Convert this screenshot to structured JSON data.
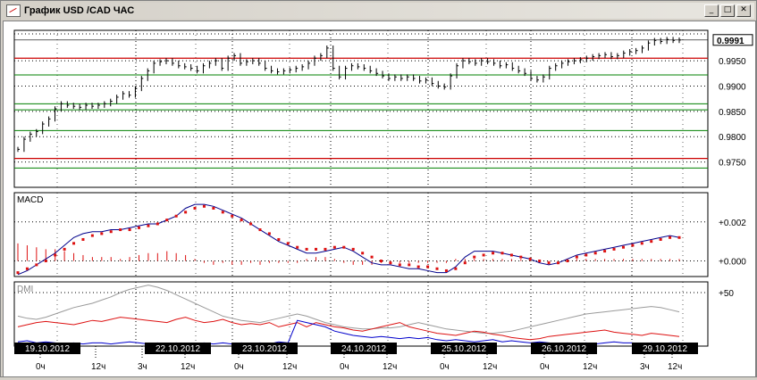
{
  "window": {
    "title": "График USD /CAD  ЧАС",
    "buttons": {
      "minimize": "_",
      "maximize": "□",
      "close": "✕"
    }
  },
  "chart_data": [
    {
      "type": "line",
      "panel": "price",
      "ylim": [
        0.97,
        1.001
      ],
      "yticks": [
        0.975,
        0.98,
        0.985,
        0.99,
        0.995
      ],
      "ytick_labels": [
        "0.9750",
        "0.9800",
        "0.9850",
        "0.9900",
        "0.9950"
      ],
      "last_value_label": "0.9991",
      "last_value": 0.9991,
      "levels_red": [
        0.9955,
        0.9757
      ],
      "levels_green": [
        0.9922,
        0.9865,
        0.9853,
        0.9812,
        0.9738
      ],
      "close": [
        0.9775,
        0.9795,
        0.9805,
        0.981,
        0.9825,
        0.9835,
        0.9855,
        0.9865,
        0.9862,
        0.986,
        0.9858,
        0.9862,
        0.986,
        0.9862,
        0.9865,
        0.987,
        0.9878,
        0.9885,
        0.9882,
        0.9895,
        0.9915,
        0.993,
        0.9945,
        0.9948,
        0.995,
        0.9945,
        0.994,
        0.9938,
        0.9935,
        0.993,
        0.994,
        0.9945,
        0.995,
        0.9935,
        0.9955,
        0.996,
        0.9945,
        0.9948,
        0.995,
        0.9945,
        0.9935,
        0.993,
        0.9928,
        0.993,
        0.9932,
        0.9935,
        0.9938,
        0.9945,
        0.9955,
        0.996,
        0.9975,
        0.9935,
        0.9918,
        0.9935,
        0.994,
        0.9938,
        0.9935,
        0.993,
        0.9925,
        0.992,
        0.9915,
        0.9918,
        0.9915,
        0.9918,
        0.9915,
        0.991,
        0.9912,
        0.9905,
        0.99,
        0.9898,
        0.992,
        0.994,
        0.995,
        0.9948,
        0.9945,
        0.995,
        0.9948,
        0.9945,
        0.994,
        0.9942,
        0.9935,
        0.993,
        0.9925,
        0.9915,
        0.9912,
        0.9918,
        0.9935,
        0.994,
        0.9945,
        0.9948,
        0.995,
        0.9952,
        0.9955,
        0.9958,
        0.996,
        0.9962,
        0.9958,
        0.996,
        0.9965,
        0.9968,
        0.997,
        0.9975,
        0.9985,
        0.999,
        0.9988,
        0.9992,
        0.999,
        0.9991
      ]
    },
    {
      "type": "line",
      "panel": "macd",
      "label": "MACD",
      "ylim": [
        -0.0008,
        0.0035
      ],
      "yticks": [
        0.0,
        0.002
      ],
      "ytick_labels": [
        "+0.000",
        "+0.002"
      ],
      "macd": [
        -0.0007,
        -0.0005,
        -0.0002,
        0.0001,
        0.0004,
        0.0008,
        0.0012,
        0.0014,
        0.0015,
        0.0015,
        0.0016,
        0.0016,
        0.0017,
        0.0018,
        0.0019,
        0.0019,
        0.0021,
        0.0023,
        0.0027,
        0.0029,
        0.0029,
        0.0028,
        0.0026,
        0.0024,
        0.0022,
        0.0019,
        0.0016,
        0.0013,
        0.001,
        0.0008,
        0.0006,
        0.0004,
        0.0004,
        0.0005,
        0.0006,
        0.0007,
        0.0005,
        0.0002,
        -0.0001,
        -0.0002,
        -0.0002,
        -0.0003,
        -0.0004,
        -0.0004,
        -0.0005,
        -0.0006,
        -0.0006,
        -0.0003,
        0.0002,
        0.0005,
        0.0005,
        0.0005,
        0.0004,
        0.0003,
        0.0002,
        0.0001,
        -0.0001,
        -0.0002,
        -0.0001,
        0.0001,
        0.0003,
        0.0004,
        0.0005,
        0.0006,
        0.0007,
        0.0008,
        0.0009,
        0.001,
        0.0011,
        0.0012,
        0.0013,
        0.0012
      ],
      "signal": [
        -0.0006,
        -0.0004,
        -0.0002,
        0.0,
        0.0003,
        0.0006,
        0.0009,
        0.0011,
        0.0013,
        0.0014,
        0.0015,
        0.0016,
        0.0016,
        0.0017,
        0.0018,
        0.0019,
        0.0021,
        0.0023,
        0.0025,
        0.0027,
        0.0028,
        0.0027,
        0.0025,
        0.0023,
        0.0021,
        0.0019,
        0.0016,
        0.0014,
        0.0011,
        0.0009,
        0.0007,
        0.0006,
        0.0006,
        0.0006,
        0.0007,
        0.0007,
        0.0006,
        0.0004,
        0.0002,
        0.0,
        -0.0001,
        -0.0002,
        -0.0002,
        -0.0003,
        -0.0003,
        -0.0004,
        -0.0005,
        -0.0004,
        -0.0001,
        0.0002,
        0.0003,
        0.0004,
        0.0004,
        0.0003,
        0.0002,
        0.0001,
        0.0,
        -0.0001,
        -0.0001,
        0.0,
        0.0002,
        0.0003,
        0.0004,
        0.0005,
        0.0006,
        0.0007,
        0.0008,
        0.0009,
        0.001,
        0.0011,
        0.0012,
        0.0012
      ],
      "histogram": [
        0.0009,
        0.0008,
        0.0007,
        0.0006,
        0.0006,
        0.0005,
        0.0004,
        0.0003,
        0.0002,
        0.0002,
        0.0002,
        0.0001,
        0.0002,
        0.0003,
        0.0004,
        0.0004,
        0.0005,
        0.0004,
        0.0003,
        0.0001,
        -0.0001,
        -0.0002,
        -0.0001,
        -0.0002,
        -0.0002,
        -0.0001,
        -0.0002,
        -0.0001,
        -0.0001,
        -0.0001,
        -0.0001,
        0.0001,
        0.0002,
        0.0002,
        0.0001,
        -0.0001,
        -0.0002,
        -0.0002,
        -0.0002,
        -0.0001,
        -0.0001,
        -0.0001,
        -0.0001,
        -0.0001,
        -0.0001,
        -0.0001,
        -0.0001,
        0.0001,
        0.0001,
        0.0001,
        0.0001,
        0.0001,
        0.0001,
        0.0001,
        0.0001,
        0.0001,
        -0.0001,
        -0.0001,
        0.0,
        0.0001,
        0.0001,
        0.0001,
        0.0001,
        0.0001,
        0.0001,
        0.0001,
        0.0001,
        0.0001,
        0.0001,
        0.0001,
        0.0001,
        0.0001
      ]
    },
    {
      "type": "line",
      "panel": "dmi",
      "label": "DMI",
      "ylim": [
        0,
        60
      ],
      "yticks": [
        50
      ],
      "ytick_labels": [
        "+50"
      ],
      "adx": [
        28,
        26,
        25,
        27,
        30,
        33,
        36,
        38,
        40,
        43,
        46,
        50,
        53,
        55,
        57,
        55,
        52,
        48,
        44,
        40,
        36,
        32,
        28,
        26,
        24,
        23,
        22,
        24,
        26,
        28,
        30,
        28,
        25,
        22,
        20,
        18,
        17,
        16,
        16,
        17,
        17,
        18,
        20,
        22,
        20,
        18,
        16,
        15,
        14,
        13,
        12,
        12,
        13,
        14,
        16,
        18,
        20,
        22,
        24,
        26,
        28,
        30,
        31,
        32,
        33,
        34,
        35,
        36,
        37,
        36,
        34,
        32
      ],
      "plus_di": [
        18,
        20,
        22,
        23,
        22,
        21,
        20,
        22,
        24,
        23,
        25,
        27,
        26,
        25,
        24,
        23,
        22,
        25,
        27,
        24,
        22,
        23,
        25,
        22,
        20,
        21,
        20,
        22,
        18,
        20,
        22,
        18,
        22,
        20,
        18,
        17,
        15,
        14,
        16,
        18,
        20,
        22,
        18,
        16,
        14,
        12,
        11,
        10,
        12,
        14,
        13,
        11,
        10,
        8,
        7,
        6,
        7,
        9,
        10,
        11,
        12,
        13,
        14,
        15,
        13,
        12,
        11,
        10,
        12,
        11,
        10,
        9
      ],
      "minus_di": [
        4,
        5,
        3,
        4,
        3,
        2,
        3,
        2,
        3,
        3,
        2,
        3,
        4,
        3,
        2,
        3,
        2,
        3,
        2,
        2,
        3,
        2,
        3,
        2,
        3,
        2,
        3,
        2,
        4,
        3,
        24,
        22,
        20,
        18,
        14,
        12,
        10,
        9,
        8,
        9,
        8,
        7,
        8,
        7,
        8,
        6,
        5,
        6,
        5,
        4,
        5,
        6,
        4,
        5,
        4,
        3,
        4,
        3,
        2,
        3,
        2,
        3,
        2,
        3,
        4,
        3,
        3,
        2,
        3,
        2,
        3,
        3
      ]
    }
  ],
  "dates": [
    {
      "label": "19.10.2012"
    },
    {
      "label": "22.10.2012"
    },
    {
      "label": "23.10.2012"
    },
    {
      "label": "24.10.2012"
    },
    {
      "label": "25.10.2012"
    },
    {
      "label": "26.10.2012"
    },
    {
      "label": "29.10.2012"
    }
  ],
  "hours": [
    "0ч",
    "12ч",
    "3ч",
    "12ч",
    "0ч",
    "12ч",
    "0ч",
    "12ч",
    "0ч",
    "12ч",
    "0ч",
    "12ч",
    "3ч",
    "12ч"
  ],
  "colors": {
    "price_bar": "#000000",
    "level_red": "#cc0000",
    "level_green": "#008000",
    "macd_line": "#00008b",
    "signal_dots": "#dd1111",
    "histogram": "#dd1111",
    "adx": "#9a9a9a",
    "plus_di": "#dd1111",
    "minus_di": "#0000cc",
    "date_box": "#000000"
  }
}
